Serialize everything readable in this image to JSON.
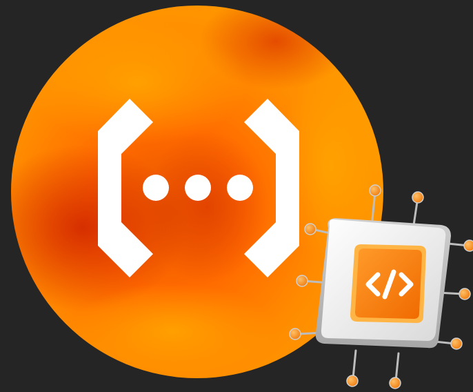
{
  "canvas": {
    "background": "#252525"
  },
  "logo": {
    "icon": "ellipsis-in-brackets-icon",
    "circle_colors": [
      "#ff9a00",
      "#ff7a00",
      "#e23a00",
      "#ff5a00"
    ],
    "glyph_color": "#ffffff"
  },
  "chip": {
    "icon": "code-tag-icon",
    "label": "</>",
    "body_color": "#f2f2f2",
    "die_color": "#ff8a1a",
    "pin_color": "#ff9a2a"
  }
}
